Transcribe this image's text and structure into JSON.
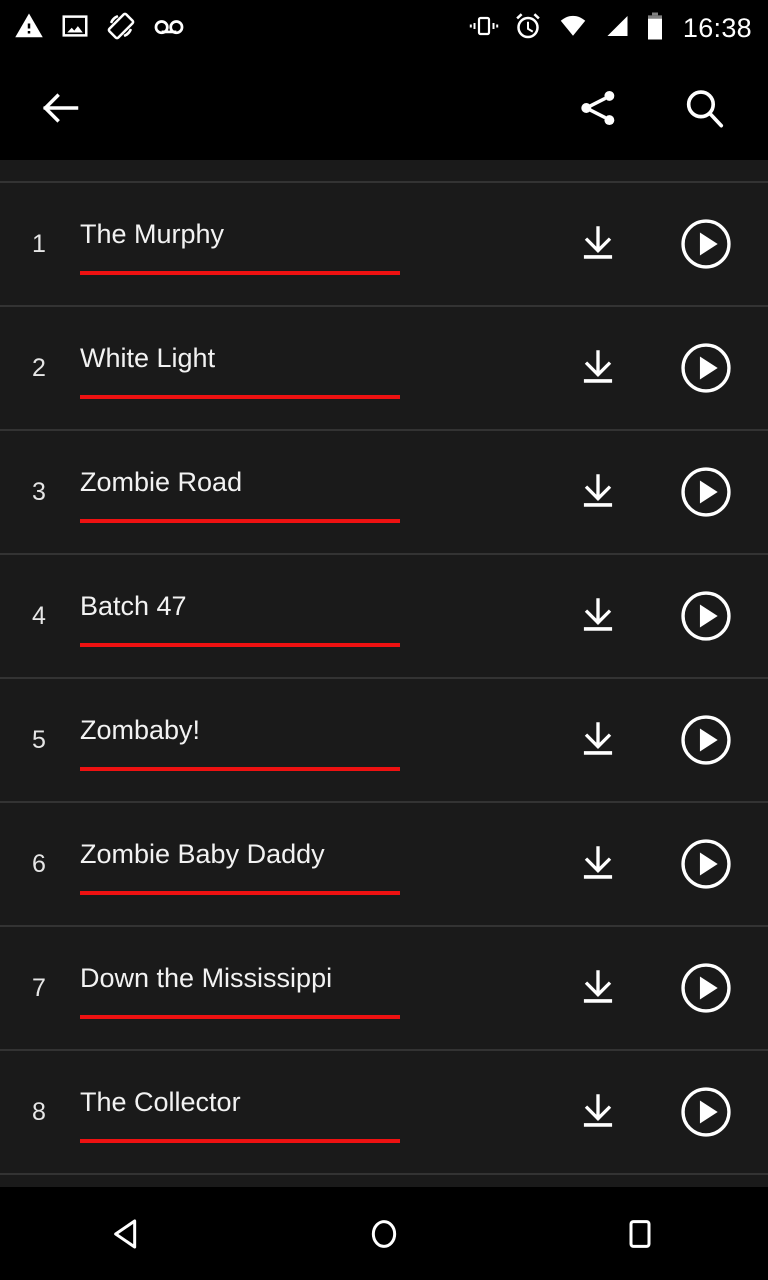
{
  "status_bar": {
    "time": "16:38",
    "left_icons": [
      "warning-icon",
      "image-icon",
      "screen-rotation-icon",
      "voicemail-icon"
    ],
    "right_icons": [
      "vibrate-icon",
      "alarm-icon",
      "wifi-icon",
      "signal-icon",
      "battery-icon"
    ]
  },
  "app_bar": {
    "back_label": "back-arrow-icon",
    "share_label": "share-icon",
    "search_label": "search-icon"
  },
  "theme": {
    "accent": "#ee1111",
    "background": "#1a1a1a",
    "bar_background": "#000000",
    "divider": "#333333",
    "text": "#f2f2f2"
  },
  "tracklist": {
    "rows": [
      {
        "number": "1",
        "title": "The Murphy",
        "download": "download-icon",
        "play": "play-icon"
      },
      {
        "number": "2",
        "title": "White Light",
        "download": "download-icon",
        "play": "play-icon"
      },
      {
        "number": "3",
        "title": "Zombie Road",
        "download": "download-icon",
        "play": "play-icon"
      },
      {
        "number": "4",
        "title": "Batch 47",
        "download": "download-icon",
        "play": "play-icon"
      },
      {
        "number": "5",
        "title": "Zombaby!",
        "download": "download-icon",
        "play": "play-icon"
      },
      {
        "number": "6",
        "title": "Zombie Baby Daddy",
        "download": "download-icon",
        "play": "play-icon"
      },
      {
        "number": "7",
        "title": "Down the Mississippi",
        "download": "download-icon",
        "play": "play-icon"
      },
      {
        "number": "8",
        "title": "The Collector",
        "download": "download-icon",
        "play": "play-icon"
      }
    ]
  },
  "nav_bar": {
    "back": "nav-back-icon",
    "home": "nav-home-icon",
    "recents": "nav-recents-icon"
  }
}
